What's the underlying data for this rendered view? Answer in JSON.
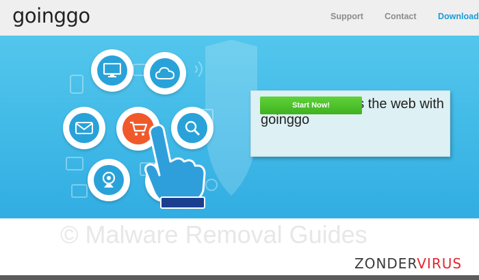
{
  "header": {
    "logo_text": "goinggo",
    "nav": [
      "Support",
      "Contact",
      "Download"
    ]
  },
  "hero": {
    "headline": "Get going across the web with goinggo",
    "cta_label": "Start Now!",
    "icons": [
      "monitor-icon",
      "cloud-icon",
      "mail-icon",
      "shopping-cart-icon",
      "search-icon",
      "webcam-icon",
      "pointing-hand-icon"
    ]
  },
  "overlay": {
    "watermark": "© Malware Removal Guides",
    "brand_part1": "ZONDER",
    "brand_part2": "VIRUS"
  },
  "colors": {
    "accent_blue": "#1e9bd6",
    "hero_blue": "#40b9e7",
    "cta_green": "#46b924",
    "cart_orange": "#f05a2a",
    "brand_red": "#e3262d"
  }
}
